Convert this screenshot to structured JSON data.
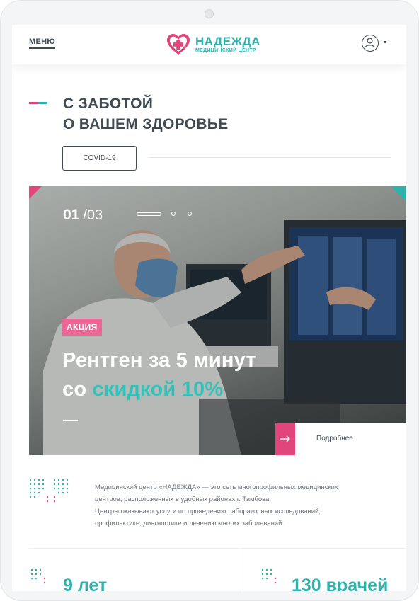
{
  "header": {
    "menu_label": "МЕНЮ",
    "logo_title": "НАДЕЖДА",
    "logo_subtitle": "МЕДИЦИНСКИЙ ЦЕНТР"
  },
  "hero": {
    "title_line1": "С ЗАБОТОЙ",
    "title_line2": "О ВАШЕМ ЗДОРОВЬЕ",
    "covid_button": "COVID-19"
  },
  "slider": {
    "current": "01",
    "total": "/03",
    "slides_count": 3,
    "active_index": 0,
    "badge": "АКЦИЯ",
    "title_line1": "Рентген за 5 минут",
    "title_line2_plain": "со ",
    "title_line2_accent": "скидкой 10%",
    "more_label": "Подробнее"
  },
  "about": {
    "line1": "Медицинский центр «НАДЕЖДА» — это сеть многопрофильных медицинских",
    "line2": "центров, расположенных в удобных районах г. Тамбова.",
    "line3": "Центры оказывают услуги по проведению лабораторных исследований,",
    "line4": "профилактике, диагностике и лечению многих заболеваний."
  },
  "stats": {
    "years": "9 лет",
    "doctors": "130 врачей"
  },
  "colors": {
    "teal": "#2fb2ac",
    "pink": "#e0457b",
    "badge_pink": "#ec6796",
    "dark": "#3f4a52"
  },
  "icons": {
    "profile": "user-icon",
    "caret": "chevron-down-icon",
    "arrow": "arrow-right-icon",
    "logo": "heart-cross-icon"
  }
}
